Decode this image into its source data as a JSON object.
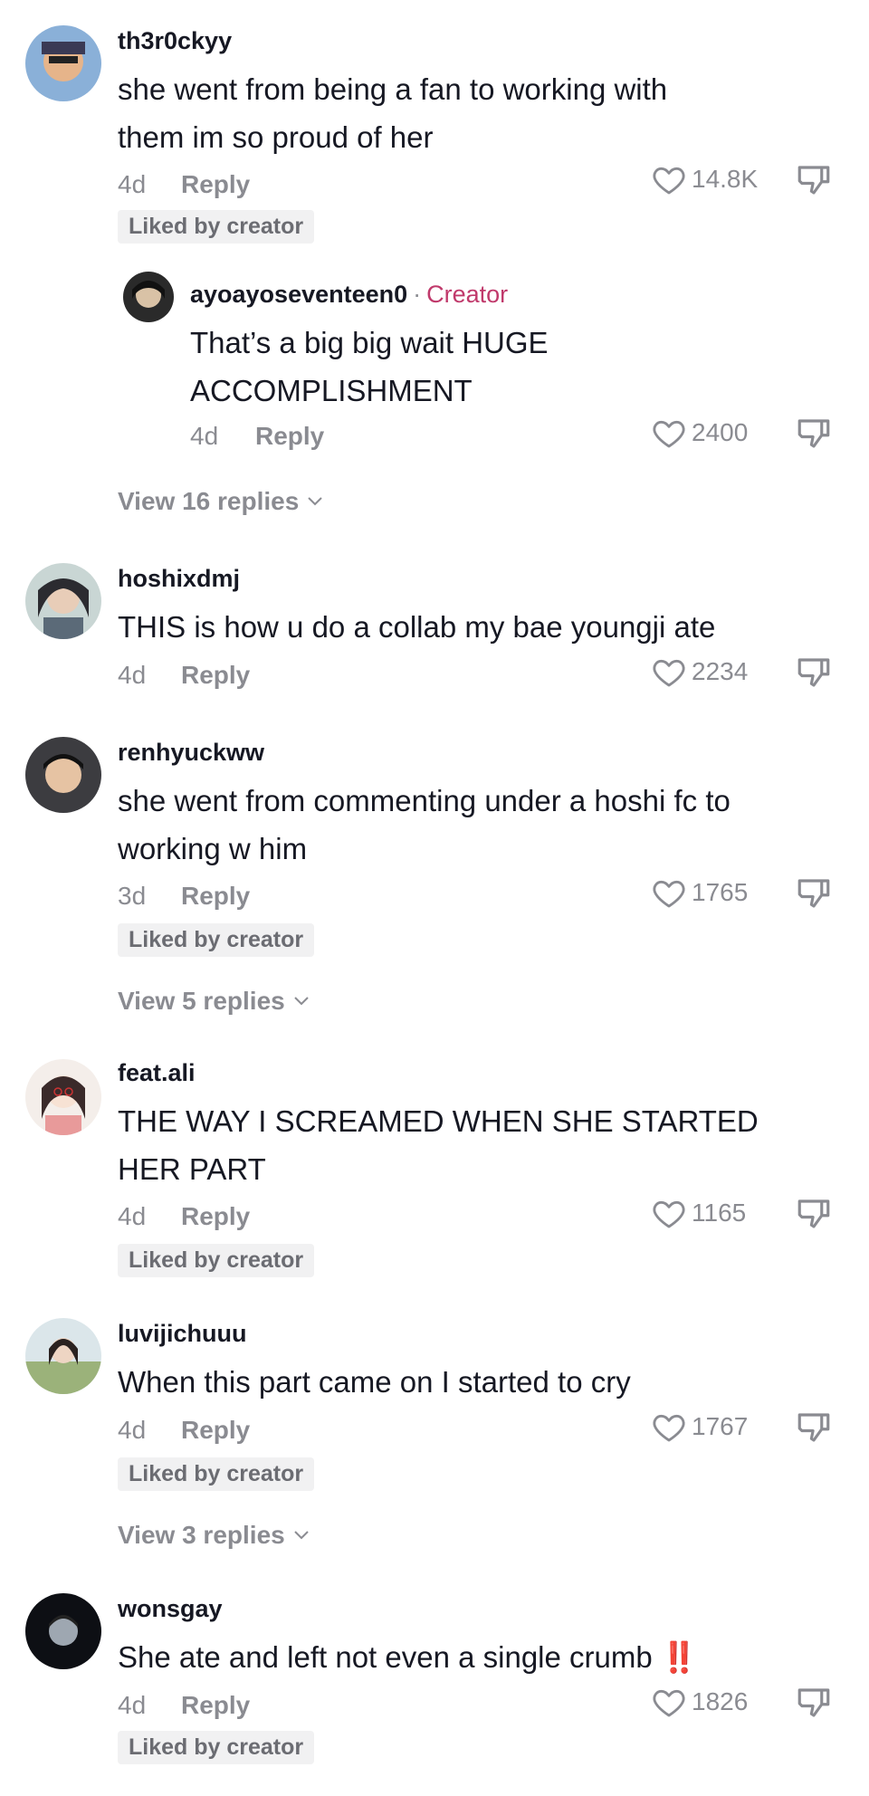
{
  "comments": [
    {
      "username": "th3r0ckyy",
      "text": "she went from being a fan to working with them im so proud of her",
      "age": "4d",
      "reply_label": "Reply",
      "likes": "14.8K",
      "liked_by_creator": "Liked by creator",
      "creator_reply": {
        "username": "ayoayoseventeen0",
        "tag": "Creator",
        "text": "That’s a big big wait HUGE ACCOMPLISHMENT",
        "age": "4d",
        "reply_label": "Reply",
        "likes": "2400"
      },
      "view_replies": "View 16 replies"
    },
    {
      "username": "hoshixdmj",
      "text": "THIS is how u do a collab my bae youngji ate",
      "age": "4d",
      "reply_label": "Reply",
      "likes": "2234"
    },
    {
      "username": "renhyuckww",
      "text": "she went from commenting under a hoshi fc to working w him",
      "age": "3d",
      "reply_label": "Reply",
      "likes": "1765",
      "liked_by_creator": "Liked by creator",
      "view_replies": "View 5 replies"
    },
    {
      "username": "feat.ali",
      "text": "THE WAY I SCREAMED WHEN SHE STARTED HER PART",
      "age": "4d",
      "reply_label": "Reply",
      "likes": "1165",
      "liked_by_creator": "Liked by creator"
    },
    {
      "username": "luvijichuuu",
      "text": "When this part came on I started to cry",
      "age": "4d",
      "reply_label": "Reply",
      "likes": "1767",
      "liked_by_creator": "Liked by creator",
      "view_replies": "View 3 replies"
    },
    {
      "username": "wonsgay",
      "text": "She ate and left not even a single crumb",
      "emoji": "‼️",
      "age": "4d",
      "reply_label": "Reply",
      "likes": "1826",
      "liked_by_creator": "Liked by creator"
    }
  ],
  "icons": {
    "like": "heart-outline-icon",
    "dislike": "thumbs-down-icon",
    "expand": "chevron-down-icon"
  },
  "colors": {
    "creator_tag": "#c0396b",
    "secondary_text": "#8a8b91",
    "badge_bg": "#f1f1f2"
  }
}
